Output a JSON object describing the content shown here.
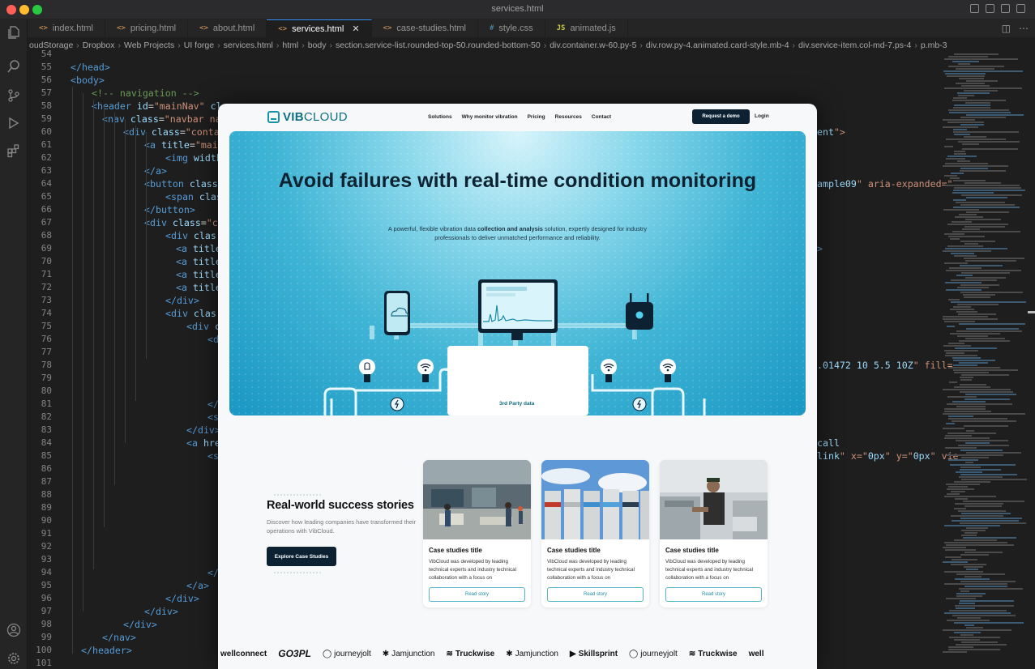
{
  "window": {
    "title": "services.html"
  },
  "tabs": [
    {
      "icon": "<>",
      "label": "index.html"
    },
    {
      "icon": "<>",
      "label": "pricing.html"
    },
    {
      "icon": "<>",
      "label": "about.html"
    },
    {
      "icon": "<>",
      "label": "services.html",
      "active": true
    },
    {
      "icon": "<>",
      "label": "case-studies.html"
    },
    {
      "icon": "#",
      "label": "style.css"
    },
    {
      "icon": "JS",
      "label": "animated.js"
    }
  ],
  "breadcrumb": [
    "oudStorage",
    "Dropbox",
    "Web Projects",
    "UI forge",
    "services.html",
    "html",
    "body",
    "section.service-list.rounded-top-50.rounded-bottom-50",
    "div.container.w-60.py-5",
    "div.row.py-4.animated.card-style.mb-4",
    "div.service-item.col-md-7.ps-4",
    "p.mb-3"
  ],
  "line_numbers": [
    "54",
    "55",
    "56",
    "57",
    "58",
    "59",
    "60",
    "61",
    "62",
    "63",
    "64",
    "65",
    "66",
    "67",
    "68",
    "69",
    "70",
    "71",
    "72",
    "73",
    "74",
    "75",
    "76",
    "77",
    "78",
    "79",
    "80",
    "81",
    "82",
    "83",
    "84",
    "85",
    "86",
    "87",
    "88",
    "89",
    "90",
    "91",
    "92",
    "93",
    "94",
    "95",
    "96",
    "97",
    "98",
    "99",
    "100",
    "101"
  ],
  "code_lines": [
    {
      "indent": 0,
      "text": ""
    },
    {
      "indent": 0,
      "text": "</head>"
    },
    {
      "indent": 0,
      "text": "<body>"
    },
    {
      "indent": 2,
      "text": "<!-- navigation -->"
    },
    {
      "indent": 2,
      "text": "<header id=\"mainNav\" cla"
    },
    {
      "indent": 3,
      "text": "<nav class=\"navbar navb"
    },
    {
      "indent": 5,
      "text": "<div class=\"contai"
    },
    {
      "indent": 7,
      "text": "<a title=\"main"
    },
    {
      "indent": 9,
      "text": "<img width="
    },
    {
      "indent": 7,
      "text": "</a>"
    },
    {
      "indent": 7,
      "text": "<button class=\""
    },
    {
      "indent": 9,
      "text": "<span clas"
    },
    {
      "indent": 7,
      "text": "</button>"
    },
    {
      "indent": 7,
      "text": "<div class=\"co"
    },
    {
      "indent": 9,
      "text": "<div clas"
    },
    {
      "indent": 10,
      "text": "<a title="
    },
    {
      "indent": 10,
      "text": "<a title="
    },
    {
      "indent": 10,
      "text": "<a title="
    },
    {
      "indent": 10,
      "text": "<a title="
    },
    {
      "indent": 9,
      "text": "</div>"
    },
    {
      "indent": 9,
      "text": "<div clas"
    },
    {
      "indent": 11,
      "text": "<div cl"
    },
    {
      "indent": 13,
      "text": "<di"
    },
    {
      "indent": 0,
      "text": ""
    },
    {
      "indent": 0,
      "text": ""
    },
    {
      "indent": 0,
      "text": ""
    },
    {
      "indent": 0,
      "text": ""
    },
    {
      "indent": 13,
      "text": "</"
    },
    {
      "indent": 13,
      "text": "<s"
    },
    {
      "indent": 11,
      "text": "</div>"
    },
    {
      "indent": 11,
      "text": "<a hre"
    },
    {
      "indent": 13,
      "text": "<s"
    },
    {
      "indent": 0,
      "text": ""
    },
    {
      "indent": 0,
      "text": ""
    },
    {
      "indent": 0,
      "text": ""
    },
    {
      "indent": 0,
      "text": ""
    },
    {
      "indent": 0,
      "text": ""
    },
    {
      "indent": 0,
      "text": ""
    },
    {
      "indent": 0,
      "text": ""
    },
    {
      "indent": 0,
      "text": ""
    },
    {
      "indent": 13,
      "text": "</s"
    },
    {
      "indent": 11,
      "text": "</a>"
    },
    {
      "indent": 9,
      "text": "</div>"
    },
    {
      "indent": 7,
      "text": "</div>"
    },
    {
      "indent": 5,
      "text": "</div>"
    },
    {
      "indent": 3,
      "text": "</nav>"
    },
    {
      "indent": 1,
      "text": "</header>"
    },
    {
      "indent": 0,
      "text": ""
    }
  ],
  "right_code": [
    {
      "line": 60,
      "text": "ent\">"
    },
    {
      "line": 64,
      "text": "ample09\" aria-expanded=\""
    },
    {
      "line": 69,
      "text": ">"
    },
    {
      "line": 78,
      "text": ".01472 10 5.5 10Z\" fill="
    },
    {
      "line": 84,
      "text": "call"
    },
    {
      "line": 85,
      "text": "link\" x=\"0px\" y=\"0px\" vie"
    }
  ],
  "preview": {
    "brand": {
      "part1": "VIB",
      "part2": "CLOUD"
    },
    "nav_links": [
      "Solutions",
      "Why monitor vibration",
      "Pricing",
      "Resources",
      "Contact"
    ],
    "request_demo": "Request a demo",
    "login": "Login",
    "hero": {
      "title": "Avoid failures with real-time condition monitoring",
      "subtitle_pre": "A powerful, flexible vibration data ",
      "subtitle_bold": "collection and analysis",
      "subtitle_post": " solution, expertly designed for industry professionals to deliver unmatched performance and reliability.",
      "third_party": "3rd Party data"
    },
    "stories": {
      "title": "Real-world success stories",
      "description": "Discover how leading companies have transformed their operations with VibCloud.",
      "button": "Explore Case Studies"
    },
    "cards": [
      {
        "title": "Case studies title",
        "text": "VibCloud was developed by leading technical experts and industry technical collaboration with a focus on",
        "button": "Read story",
        "image": "factory-workers"
      },
      {
        "title": "Case studies title",
        "text": "VibCloud was developed by leading technical experts and industry technical collaboration with a focus on",
        "button": "Read story",
        "image": "storage-silos"
      },
      {
        "title": "Case studies title",
        "text": "VibCloud was developed by leading technical experts and industry technical collaboration with a focus on",
        "button": "Read story",
        "image": "kitchen-worker"
      }
    ],
    "brands": [
      "wellconnect",
      "GO3PL",
      "journeyjolt",
      "Jamjunction",
      "Truckwise",
      "Jamjunction",
      "Skillsprint",
      "journeyjolt",
      "Truckwise",
      "well"
    ]
  },
  "colors": {
    "accent": "#3794ff",
    "brand_teal": "#1793a8",
    "dark_button": "#0c2233"
  }
}
